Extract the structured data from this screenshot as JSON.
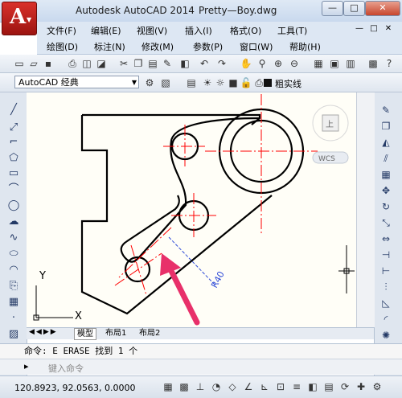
{
  "title_bar": {
    "app_title": "Autodesk AutoCAD 2014",
    "document": "Pretty—Boy.dwg"
  },
  "window_controls": {
    "minimize": "—",
    "maximize": "□",
    "close": "✕"
  },
  "menu": {
    "row1": [
      "文件(F)",
      "编辑(E)",
      "视图(V)",
      "插入(I)",
      "格式(O)",
      "工具(T)"
    ],
    "row2": [
      "绘图(D)",
      "标注(N)",
      "修改(M)",
      "参数(P)",
      "窗口(W)",
      "帮助(H)"
    ],
    "mdi_controls": [
      "—",
      "□",
      "✕"
    ]
  },
  "workspace": {
    "value": "AutoCAD 经典"
  },
  "layer": {
    "linetype": "粗实线"
  },
  "viewcube": {
    "face": "上",
    "wcs": "WCS"
  },
  "drawing": {
    "dimension_label": "R40",
    "ucs": {
      "x": "X",
      "y": "Y"
    }
  },
  "layout_tabs": [
    "模型",
    "布局1",
    "布局2"
  ],
  "command": {
    "history": "命令: E ERASE 找到 1 个",
    "prompt_placeholder": "键入命令"
  },
  "status": {
    "coordinates": "120.8923, 92.0563, 0.0000"
  },
  "icons": {
    "app": "autocad-logo",
    "pointer": "arrow-annotation",
    "colors": {
      "accent": "#c2182a",
      "red_center": "#ff0000",
      "dim_blue": "#2f4bd8",
      "arrow": "#e8306a"
    }
  }
}
